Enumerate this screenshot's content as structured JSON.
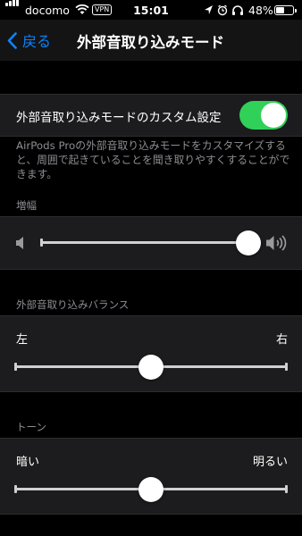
{
  "status_bar": {
    "carrier": "docomo",
    "vpn": "VPN",
    "time": "15:01",
    "battery_percent": "48%",
    "battery_level": 0.48,
    "icons": [
      "signal-icon",
      "wifi-icon",
      "location-icon",
      "alarm-icon",
      "headphones-icon",
      "battery-icon"
    ]
  },
  "nav": {
    "back_label": "戻る",
    "title": "外部音取り込みモード"
  },
  "custom": {
    "label": "外部音取り込みモードのカスタム設定",
    "enabled": true,
    "toggle_color": "#30d158",
    "footer": "AirPods Proの外部音取り込みモードをカスタマイズすると、周囲で起きていることを聞き取りやすくすることができます。"
  },
  "amplification": {
    "header": "増幅",
    "value": 0.97,
    "min_icon": "speaker-low-icon",
    "max_icon": "speaker-high-icon"
  },
  "balance": {
    "header": "外部音取り込みバランス",
    "left_label": "左",
    "right_label": "右",
    "value": 0.5
  },
  "tone": {
    "header": "トーン",
    "left_label": "暗い",
    "right_label": "明るい",
    "value": 0.5
  },
  "colors": {
    "accent": "#0a84ff",
    "cell_background": "#1c1c1e",
    "secondary_text": "#8e8e93"
  }
}
